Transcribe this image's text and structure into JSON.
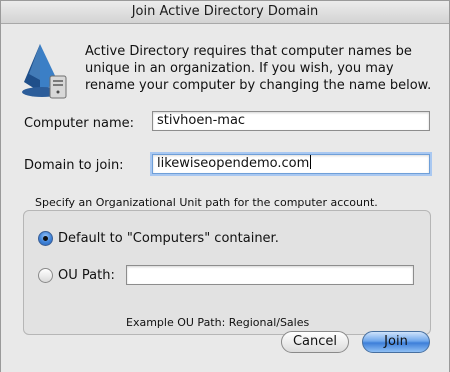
{
  "window": {
    "title": "Join Active Directory Domain"
  },
  "intro": {
    "text": "Active Directory requires that computer names be unique in an organization. If you wish, you may rename your computer by changing the name below."
  },
  "fields": {
    "computer_name_label": "Computer name:",
    "computer_name_value": "stivhoen-mac",
    "domain_label": "Domain to join:",
    "domain_value": "likewiseopendemo.com"
  },
  "ou": {
    "caption": "Specify an Organizational Unit path for the computer account.",
    "default_option_label": "Default to \"Computers\" container.",
    "ou_path_label": "OU Path:",
    "ou_path_value": "",
    "example_text": "Example OU Path: Regional/Sales",
    "selected": "default"
  },
  "buttons": {
    "cancel_label": "Cancel",
    "join_label": "Join"
  },
  "icons": {
    "app": "directory-utility-icon"
  },
  "colors": {
    "default_button": "#3d7fd9",
    "focus_ring": "#a9c8f1",
    "window_bg": "#e9e9e9"
  }
}
